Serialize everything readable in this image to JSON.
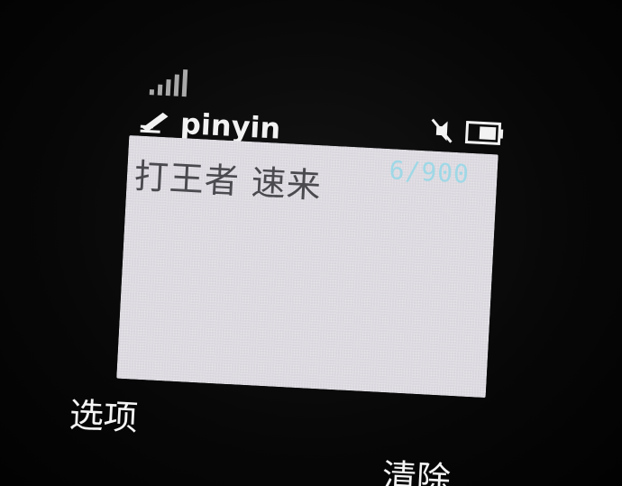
{
  "status": {
    "signal_icon": "signal-strength-icon",
    "mute_icon": "muted-icon",
    "battery_icon": "battery-icon",
    "input_method": "pinyin",
    "pen_icon": "pen-icon",
    "char_counter": "6/900"
  },
  "editor": {
    "text": "打王者 速来"
  },
  "softkeys": {
    "left": "选项",
    "right": "清除"
  },
  "colors": {
    "screen_bg": "#050505",
    "text_area_bg": "#d9d6dd",
    "counter_color": "#9fd8e6",
    "text_color": "#4a4a4f"
  }
}
